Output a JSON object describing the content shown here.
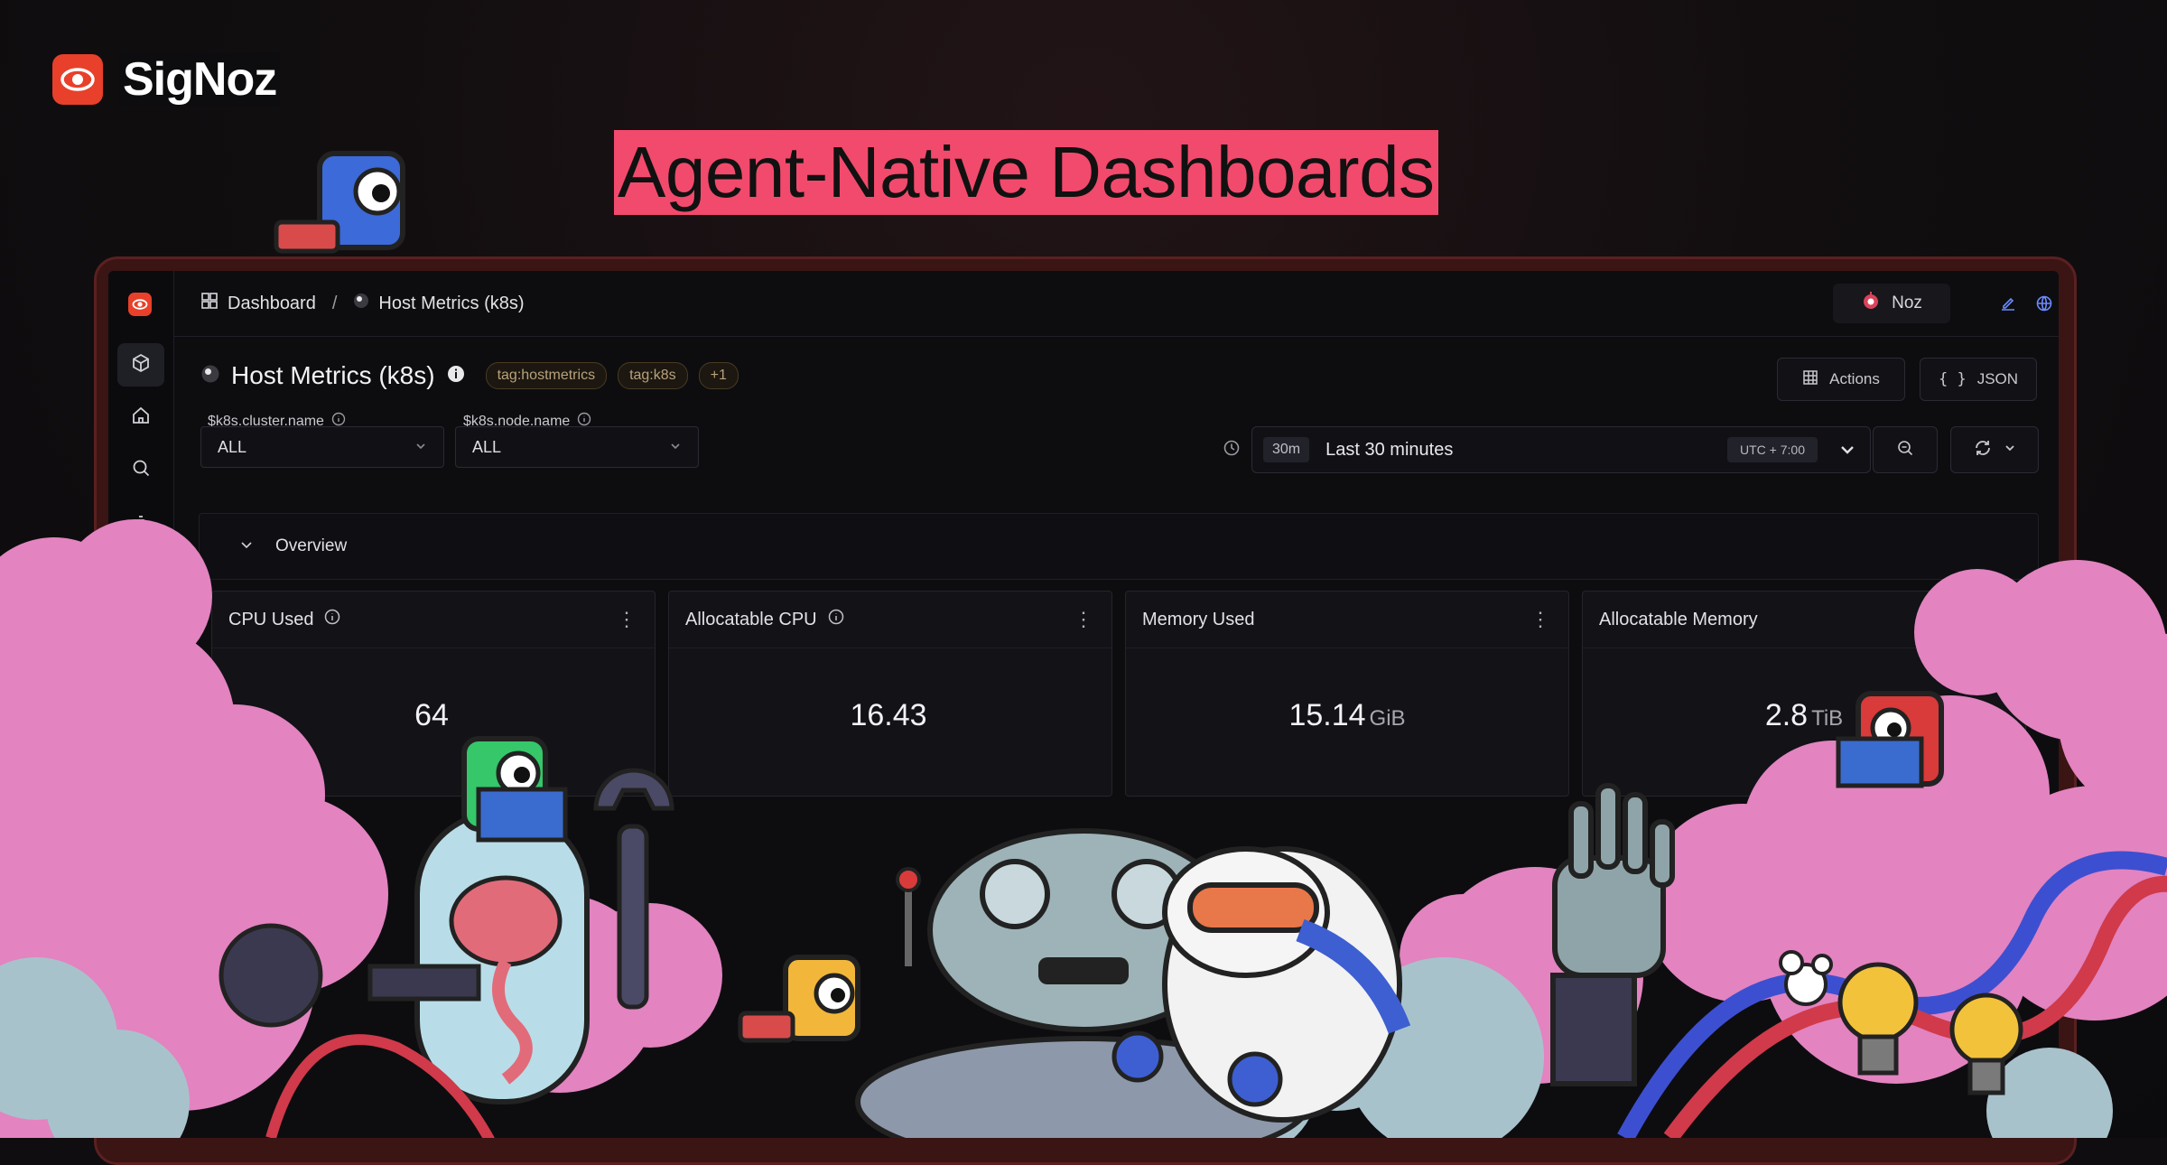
{
  "brand": {
    "name": "SigNoz",
    "icon": "eye-icon",
    "color": "#e8402a"
  },
  "hero": {
    "title": "Agent-Native Dashboards",
    "highlight_color": "#f24a6c"
  },
  "app": {
    "breadcrumb": {
      "root": "Dashboard",
      "separator": "/",
      "current": "Host Metrics (k8s)"
    },
    "topbar": {
      "assistant_label": "Noz"
    },
    "dashboard": {
      "title": "Host Metrics (k8s)",
      "tags": [
        "tag:hostmetrics",
        "tag:k8s",
        "+1"
      ],
      "actions_label": "Actions",
      "json_label": "JSON"
    },
    "variables": [
      {
        "label": "$k8s.cluster.name",
        "value": "ALL"
      },
      {
        "label": "$k8s.node.name",
        "value": "ALL"
      }
    ],
    "time": {
      "chip": "30m",
      "label": "Last 30 minutes",
      "timezone": "UTC + 7:00"
    },
    "section": {
      "label": "Overview"
    },
    "panels": [
      {
        "title": "CPU Used",
        "value": "64",
        "unit": ""
      },
      {
        "title": "Allocatable CPU",
        "value": "16.43",
        "unit": ""
      },
      {
        "title": "Memory Used",
        "value": "15.14",
        "unit": "GiB"
      },
      {
        "title": "Allocatable Memory",
        "value": "2.8",
        "unit": "TiB"
      }
    ]
  }
}
